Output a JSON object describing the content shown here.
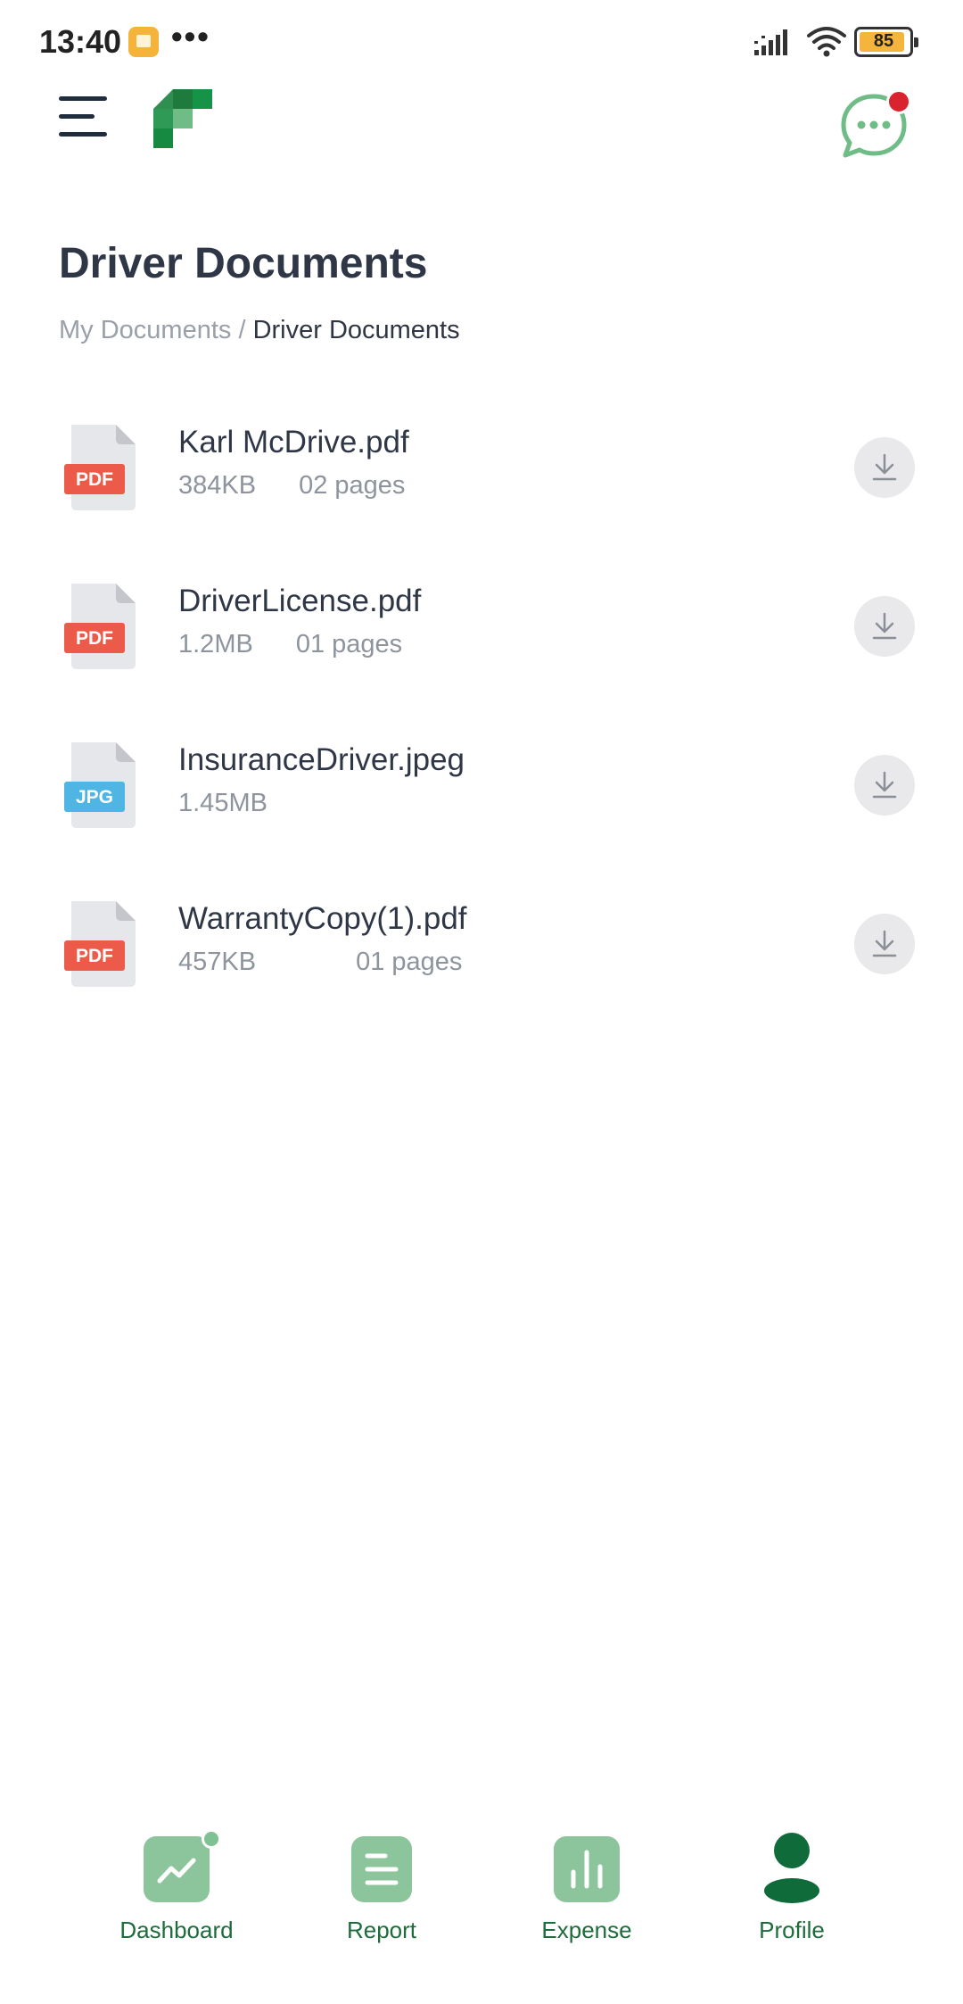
{
  "status_bar": {
    "time": "13:40",
    "more": "•••",
    "battery": "85"
  },
  "header": {
    "menu_icon": "hamburger-icon",
    "logo_icon": "logo-icon",
    "chat_icon": "chat-bubble-icon",
    "has_notification": true
  },
  "page": {
    "title": "Driver Documents",
    "breadcrumb": {
      "parent": "My Documents",
      "separator": " / ",
      "current": "Driver Documents"
    }
  },
  "files": [
    {
      "name": "Karl McDrive.pdf",
      "type": "PDF",
      "size": "384KB",
      "pages": "02 pages"
    },
    {
      "name": "DriverLicense.pdf",
      "type": "PDF",
      "size": "1.2MB",
      "pages": "01 pages"
    },
    {
      "name": "InsuranceDriver.jpeg",
      "type": "JPG",
      "size": "1.45MB",
      "pages": ""
    },
    {
      "name": "WarrantyCopy(1).pdf",
      "type": "PDF",
      "size": "457KB",
      "pages": "01 pages"
    }
  ],
  "bottom_nav": {
    "items": [
      {
        "label": "Dashboard",
        "icon": "trend-chart-icon"
      },
      {
        "label": "Report",
        "icon": "report-lines-icon"
      },
      {
        "label": "Expense",
        "icon": "bar-chart-icon"
      },
      {
        "label": "Profile",
        "icon": "person-icon"
      }
    ]
  },
  "colors": {
    "pdf_badge": "#ec5b4a",
    "jpg_badge": "#4fb5e3",
    "brand_green": "#1e6b3b",
    "nav_icon_green": "#8cc59c",
    "notification": "#d9232f"
  }
}
